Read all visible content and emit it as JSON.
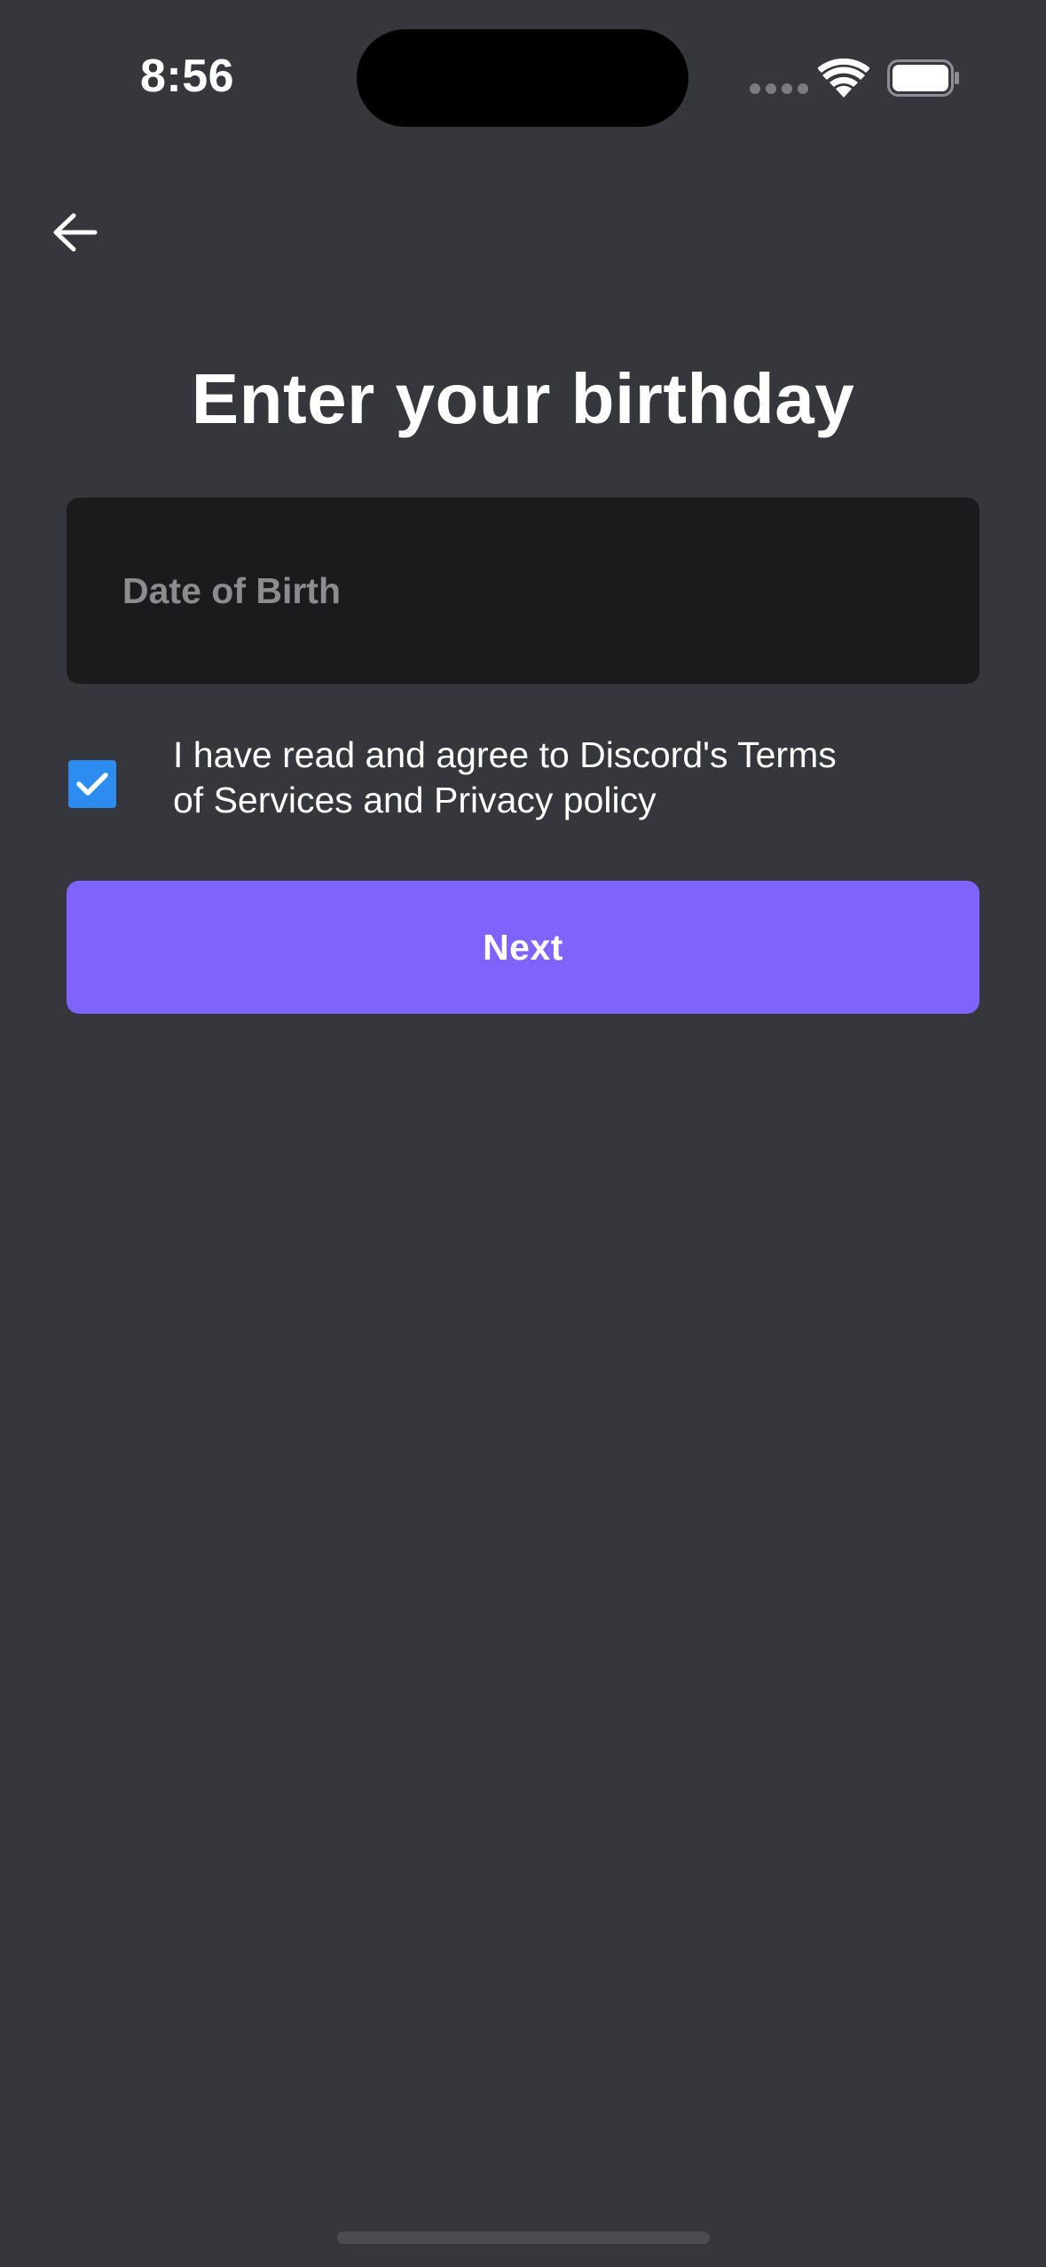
{
  "status_bar": {
    "time": "8:56",
    "icons": [
      "signal-dots-icon",
      "wifi-icon",
      "battery-icon"
    ]
  },
  "navigation": {
    "back_icon": "arrow-left-icon"
  },
  "page": {
    "title": "Enter your birthday"
  },
  "dob_field": {
    "placeholder": "Date of Birth",
    "value": ""
  },
  "terms": {
    "checked": true,
    "line1": "I have read and agree to Discord's Terms",
    "line2": "of Services and Privacy policy"
  },
  "next_button": {
    "label": "Next"
  },
  "colors": {
    "background": "#36373d",
    "input_background": "#1b1b1d",
    "placeholder": "#8c8c90",
    "checkbox": "#2d8cef",
    "primary_button": "#8062fd",
    "text": "#ffffff"
  }
}
